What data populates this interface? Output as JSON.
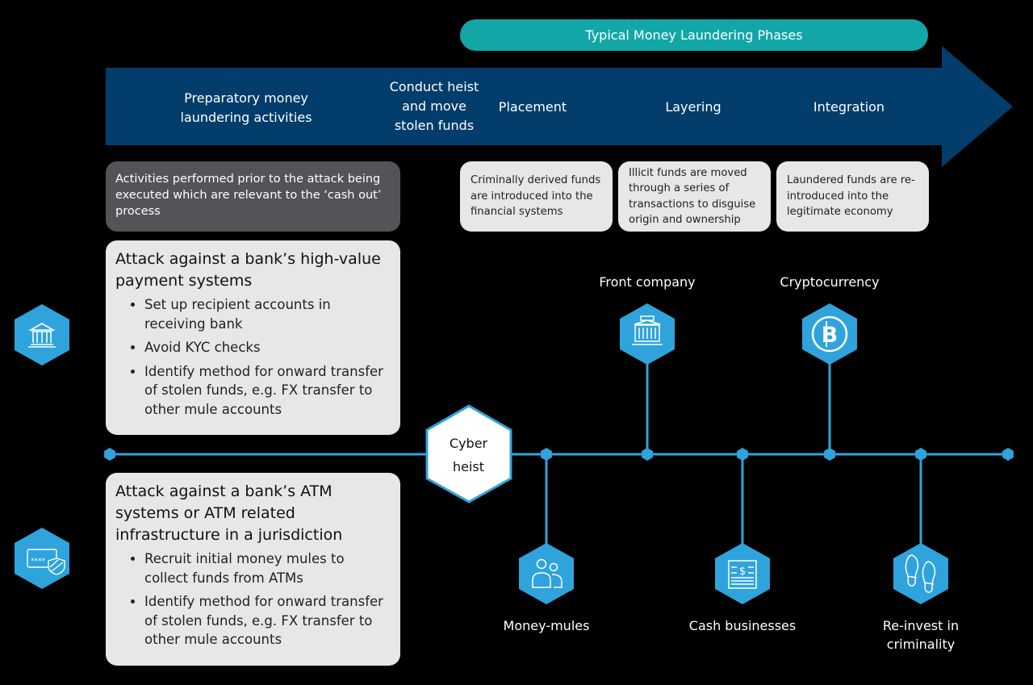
{
  "colors": {
    "background": "#000000",
    "arrow": "#033d6b",
    "teal_pill": "#13a6a7",
    "hex_blue": "#2fa3dc",
    "dark_box": "#525457",
    "light_box": "#e6e7e7"
  },
  "header": {
    "title": "Typical Money Laundering Phases"
  },
  "arrow": {
    "stages": [
      {
        "label": "Preparatory money laundering activities",
        "lines": [
          "Preparatory money",
          "laundering activities"
        ]
      },
      {
        "label": "Conduct heist and move stolen funds",
        "lines": [
          "Conduct heist",
          "and move",
          "stolen funds"
        ]
      },
      {
        "label": "Placement",
        "lines": [
          "Placement"
        ]
      },
      {
        "label": "Layering",
        "lines": [
          "Layering"
        ]
      },
      {
        "label": "Integration",
        "lines": [
          "Integration"
        ]
      }
    ]
  },
  "descriptions": {
    "preparatory": "Activities performed prior to the attack being executed which are relevant to the ‘cash out’ process",
    "placement": "Criminally derived funds are introduced into the financial systems",
    "layering": "Illicit funds are moved through a series of transactions to disguise origin and ownership",
    "integration": "Laundered funds are re-introduced into the legitimate economy"
  },
  "attacks": [
    {
      "icon": "bank-icon",
      "title": "Attack against a bank’s high-value payment systems",
      "bullets": [
        "Set up recipient accounts in receiving bank",
        "Avoid KYC checks",
        "Identify method for onward transfer of stolen funds, e.g. FX transfer to other mule accounts"
      ]
    },
    {
      "icon": "atm-card-shield-icon",
      "title": "Attack against a bank’s ATM systems or ATM related infrastructure in a jurisdiction",
      "bullets": [
        "Recruit initial money mules to collect funds from ATMs",
        "Identify method for onward transfer of stolen funds, e.g. FX transfer to other mule accounts"
      ]
    }
  ],
  "timeline": {
    "center": {
      "lines": [
        "Cyber",
        "heist"
      ]
    },
    "channels": [
      {
        "label": "Money-mules",
        "lines": [
          "Money-mules"
        ],
        "position": "below",
        "icon": "people-icon"
      },
      {
        "label": "Front company",
        "lines": [
          "Front company"
        ],
        "position": "above",
        "icon": "building-icon"
      },
      {
        "label": "Cash businesses",
        "lines": [
          "Cash businesses"
        ],
        "position": "below",
        "icon": "cash-register-icon"
      },
      {
        "label": "Cryptocurrency",
        "lines": [
          "Cryptocurrency"
        ],
        "position": "above",
        "icon": "bitcoin-icon"
      },
      {
        "label": "Re-invest in criminality",
        "lines": [
          "Re-invest in",
          "criminality"
        ],
        "position": "below",
        "icon": "footprints-icon"
      }
    ]
  }
}
